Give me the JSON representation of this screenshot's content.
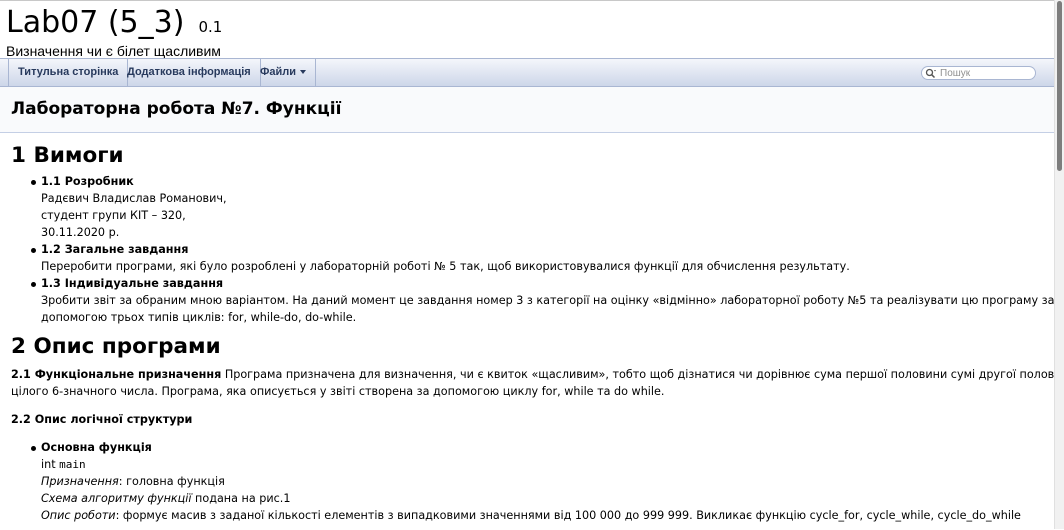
{
  "project": {
    "name": "Lab07 (5_3)",
    "number": "0.1",
    "brief": "Визначення чи є білет щасливим"
  },
  "nav": {
    "main_page": "Титульна сторінка",
    "related_pages": "Додаткова інформація",
    "files": "Файли",
    "search_placeholder": "Пошук"
  },
  "page": {
    "title": "Лабораторна робота №7. Функції"
  },
  "section1": {
    "heading": "1 Вимоги",
    "items": [
      {
        "label": "1.1 Розробник",
        "lines": [
          "Радєвич Владислав Романович,",
          "студент групи КІТ – 320,",
          "30.11.2020 р."
        ]
      },
      {
        "label": "1.2 Загальне завдання",
        "lines": [
          "Переробити програми, які було розроблені у лабораторній роботі № 5 так, щоб використовувалися функції для обчислення результату."
        ]
      },
      {
        "label": "1.3 Індивідуальне завдання",
        "lines": [
          "Зробити звіт за обраним мною варіантом. На даний момент це завдання номер 3 з категорії на оцінку «відмінно» лабораторної роботу №5 та реалізувати цю програму за",
          "допомогою трьох типів циклів: for, while-do, do-while."
        ]
      }
    ]
  },
  "section2": {
    "heading": "2 Опис програми",
    "sub1_label": "2.1 Функціональне призначення",
    "sub1_text_line1": " Програма призначена для визначення, чи є квиток «щасливим», тобто щоб дізнатися чи дорівнює сума першої половини сумі другої половини",
    "sub1_text_line2": "цілого 6-значного числа. Програма, яка описується у звіті створена за допомогою циклу for, while та do while.",
    "sub2_label": "2.2 Опис логічної структури",
    "func": {
      "label": "Основна функція",
      "signature_type": "int ",
      "signature_name": "main",
      "purpose_label": "Призначення",
      "purpose_text": ": головна функція",
      "scheme_label": "Схема алгоритму функції",
      "scheme_text": " подана на рис.1",
      "work_label": "Опис роботи",
      "work_text": ": формує масив з заданої кількості елементів з випадковими значеннями від 100 000 до 999 999. Викликає функцію cycle_for, cycle_while, cycle_do_while"
    }
  },
  "colors": {
    "nav_text": "#283a5d",
    "nav_border": "#a9b6d2",
    "header_bg": "#f9fafc"
  }
}
